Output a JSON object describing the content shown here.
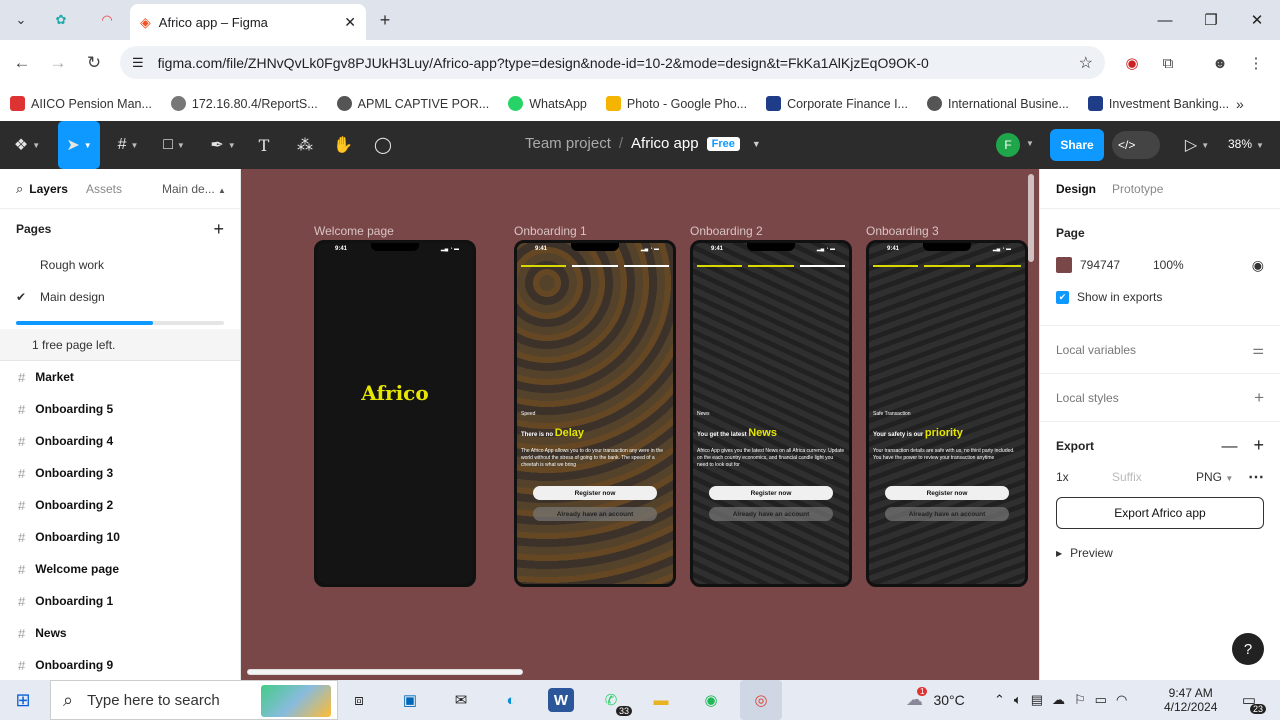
{
  "browser": {
    "tab_title": "Africo app – Figma",
    "url": "figma.com/file/ZHNvQvLk0Fgv8PJUkH3Luy/Africo-app?type=design&node-id=10-2&mode=design&t=FkKa1AlKjzEqO9OK-0",
    "bookmarks": [
      "AIICO Pension Man...",
      "172.16.80.4/ReportS...",
      "APML CAPTIVE POR...",
      "WhatsApp",
      "Photo - Google Pho...",
      "Corporate Finance I...",
      "International Busine...",
      "Investment Banking..."
    ]
  },
  "toolbar": {
    "team": "Team project",
    "file": "Africo app",
    "plan_badge": "Free",
    "avatar_initial": "F",
    "share_label": "Share",
    "zoom": "38%"
  },
  "left": {
    "tab_layers": "Layers",
    "tab_assets": "Assets",
    "page_switch": "Main de...",
    "pages_heading": "Pages",
    "pages": [
      "Rough work",
      "Main design"
    ],
    "pages_used_fraction": 0.66,
    "free_pages_note": "1 free page left.",
    "layers": [
      "Market",
      "Onboarding 5",
      "Onboarding 4",
      "Onboarding 3",
      "Onboarding 2",
      "Onboarding 10",
      "Welcome page",
      "Onboarding 1",
      "News",
      "Onboarding 9"
    ]
  },
  "canvas": {
    "bg_color": "#794747",
    "frames": [
      {
        "label": "Welcome page",
        "time": "9:41",
        "logo": "Africo"
      },
      {
        "label": "Onboarding 1",
        "time": "9:41",
        "tag": "Speed",
        "title_pre": "There is no",
        "title_hl": "Delay",
        "body": "The Africo App allows you to do your transaction any were in the world without the stress of going to the bank. The speed of a cheetah is what we bring",
        "btn1": "Register now",
        "btn2": "Already have an account"
      },
      {
        "label": "Onboarding 2",
        "time": "9:41",
        "tag": "News",
        "title_pre": "You get the latest",
        "title_hl": "News",
        "body": "Africo App gives you the latest News on all Africa currency. Update on the each country economics, and financial candle light you need to look out for",
        "btn1": "Register now",
        "btn2": "Already have an account"
      },
      {
        "label": "Onboarding 3",
        "time": "9:41",
        "tag": "Safe Transaction",
        "title_pre": "Your safety is our",
        "title_hl": "priority",
        "body": "Your transaction details are safe with us, no third party included. You have the power to review your transaction anytime",
        "btn1": "Register now",
        "btn2": "Already have an account"
      }
    ]
  },
  "right": {
    "tab_design": "Design",
    "tab_prototype": "Prototype",
    "page_heading": "Page",
    "page_color": "794747",
    "page_opacity": "100%",
    "show_exports": "Show in exports",
    "local_variables": "Local variables",
    "local_styles": "Local styles",
    "export_heading": "Export",
    "export_scale": "1x",
    "export_suffix": "Suffix",
    "export_format": "PNG",
    "export_button": "Export Africo app",
    "preview": "Preview",
    "help": "?"
  },
  "taskbar": {
    "search_placeholder": "Type here to search",
    "whatsapp_count": "33",
    "weather_badge": "1",
    "temperature": "30°C",
    "time": "9:47 AM",
    "date": "4/12/2024",
    "notif_count": "23"
  }
}
